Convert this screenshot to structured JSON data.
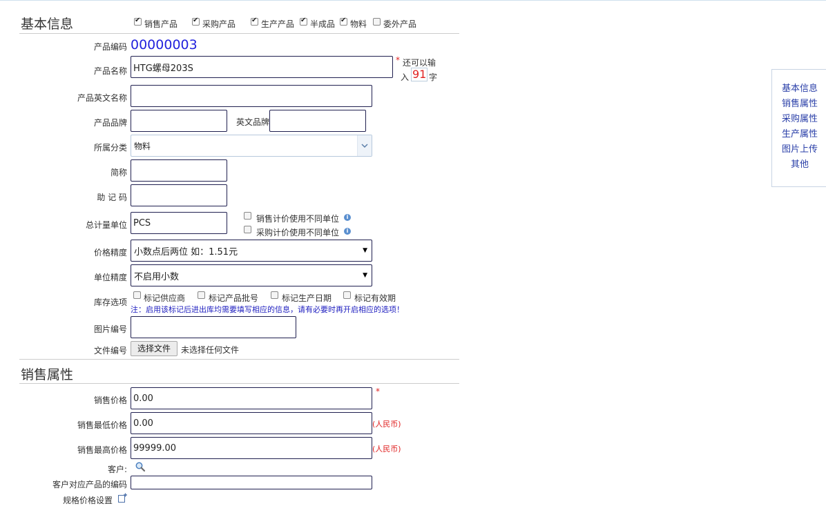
{
  "basic": {
    "title": "基本信息",
    "product_types": [
      {
        "label": "销售产品",
        "checked": true
      },
      {
        "label": "采购产品",
        "checked": true
      },
      {
        "label": "生产产品",
        "checked": true
      },
      {
        "label": "半成品",
        "checked": true
      },
      {
        "label": "物料",
        "checked": true
      },
      {
        "label": "委外产品",
        "checked": false
      }
    ],
    "code_label": "产品编码",
    "code_value": "00000003",
    "name_label": "产品名称",
    "name_value": "HTG螺母203S",
    "name_required": "*",
    "remain_prefix": "还可以输",
    "remain_mid": "入",
    "remain_count": "91",
    "remain_suffix": "字",
    "english_name_label": "产品英文名称",
    "english_name_value": "",
    "brand_label": "产品品牌",
    "brand_value": "",
    "english_brand_label": "英文品牌",
    "english_brand_value": "",
    "category_label": "所属分类",
    "category_value": "物料",
    "short_name_label": "简称",
    "short_name_value": "",
    "mnemonic_label": "助 记 码",
    "mnemonic_value": "",
    "unit_label": "总计量单位",
    "unit_value": "PCS",
    "sale_unit_option": "销售计价使用不同单位",
    "purchase_unit_option": "采购计价使用不同单位",
    "price_precision_label": "价格精度",
    "price_precision_value": "小数点后两位 如：1.51元",
    "unit_precision_label": "单位精度",
    "unit_precision_value": "不启用小数",
    "stock_label": "库存选项",
    "stock_options": [
      "标记供应商",
      "标记产品批号",
      "标记生产日期",
      "标记有效期"
    ],
    "stock_note": "注：启用该标记后进出库均需要填写相应的信息，请有必要时再开启相应的选项！",
    "image_no_label": "图片编号",
    "image_no_value": "",
    "file_no_label": "文件编号",
    "file_button": "选择文件",
    "file_status": "未选择任何文件"
  },
  "sales": {
    "title": "销售属性",
    "price_label": "销售价格",
    "price_value": "0.00",
    "price_required": "*",
    "min_price_label": "销售最低价格",
    "min_price_value": "0.00",
    "min_price_unit": "(人民币)",
    "max_price_label": "销售最高价格",
    "max_price_value": "99999.00",
    "max_price_unit": "(人民币)",
    "customer_label": "客户:",
    "customer_code_label": "客户对应产品的编码",
    "customer_code_value": "",
    "spec_price_label": "规格价格设置"
  },
  "sidenav": [
    "基本信息",
    "销售属性",
    "采购属性",
    "生产属性",
    "图片上传",
    "其他"
  ],
  "colors": {
    "link": "#2a3fa8",
    "code": "#2222dd",
    "required": "#e02020",
    "note": "#2020c0"
  }
}
